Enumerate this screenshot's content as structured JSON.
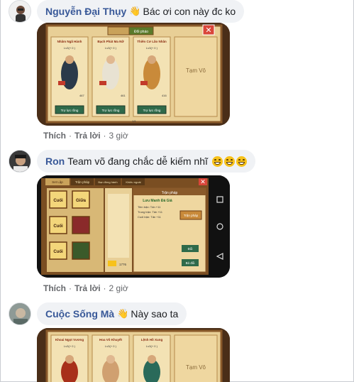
{
  "comments": [
    {
      "author": "Nguyễn Đại Thụy",
      "wave_icon": "waving-hand-icon",
      "text": "Bác ơi con này đc ko",
      "actions": {
        "like": "Thích",
        "reply": "Trả lời",
        "time": "3 giờ"
      },
      "game": {
        "tabs": [
          "",
          "Đổi pháo"
        ],
        "cards": [
          {
            "name": "Nhâm Ngã Hành",
            "level": "Lv3(+ 0 )",
            "power": "467",
            "btn": "Trợ lực rồng"
          },
          {
            "name": "Bạch Phát Ma Nữ",
            "level": "Lv3(+ 0 )",
            "power": "461",
            "btn": "Trợ lực rồng"
          },
          {
            "name": "Thiên Cơ Lão Nhân",
            "level": "Lv3(+ 0 )",
            "power": "416",
            "btn": "Trợ lực rồng"
          }
        ],
        "side_label": "Tạm Vô",
        "page": "1/1"
      }
    },
    {
      "author": "Ron",
      "text": "Team võ đang chắc dễ kiếm nhĩ",
      "emoji_icon": "grinning-face-icon",
      "actions": {
        "like": "Thích",
        "reply": "Trả lời",
        "time": "2 giờ"
      },
      "game": {
        "tabs": [
          "Set Lập",
          "Trận pháp",
          "Bạn đồng hành",
          "Khiêu ngoài"
        ],
        "slots": [
          "Cuối",
          "Giữa",
          "Cuối",
          "",
          "",
          "Cuối",
          "",
          ""
        ],
        "skill_title": "Trận pháp",
        "skill_name": "Lưu Manh Đả Giả",
        "stats": [
          "Tiền trận: Tấn   +11",
          "Trung trận: Tấn   +11",
          "Cuối trận: Tấn   +11"
        ],
        "btn_change": "Trận pháp",
        "btn_1": "Đổi",
        "btn_2": "Bỏ đổi",
        "gold": "1776"
      }
    },
    {
      "author": "Cuộc Sống Mà",
      "wave_icon": "waving-hand-icon",
      "text": "Này sao ta",
      "game": {
        "cards": [
          {
            "name": "Khoai Ngọt Vương",
            "level": "Lv3(+ 0 )"
          },
          {
            "name": "Hoa Vô Khuyết",
            "level": "Lv3(+ 0 )"
          },
          {
            "name": "Lệnh Hồ Xung",
            "level": "Lv3(+ 0 )"
          }
        ],
        "side_label": "Tạm Vô"
      }
    }
  ],
  "colors": {
    "author": "#385898",
    "bubble": "#f0f2f5",
    "meta": "#65676b"
  }
}
